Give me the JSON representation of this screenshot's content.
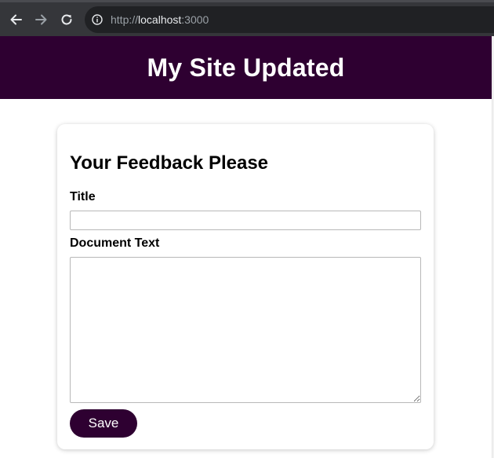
{
  "browser": {
    "url_scheme": "http://",
    "url_host": "localhost",
    "url_port": ":3000",
    "icons": {
      "back": "arrow-left-icon",
      "forward": "arrow-right-icon",
      "reload": "reload-icon",
      "info": "info-icon"
    }
  },
  "header": {
    "title": "My Site Updated"
  },
  "form": {
    "heading": "Your Feedback Please",
    "title_label": "Title",
    "title_value": "",
    "doc_label": "Document Text",
    "doc_value": "",
    "save_label": "Save"
  },
  "colors": {
    "brand": "#2e0031",
    "chrome": "#35363a",
    "omnibox": "#202124"
  }
}
